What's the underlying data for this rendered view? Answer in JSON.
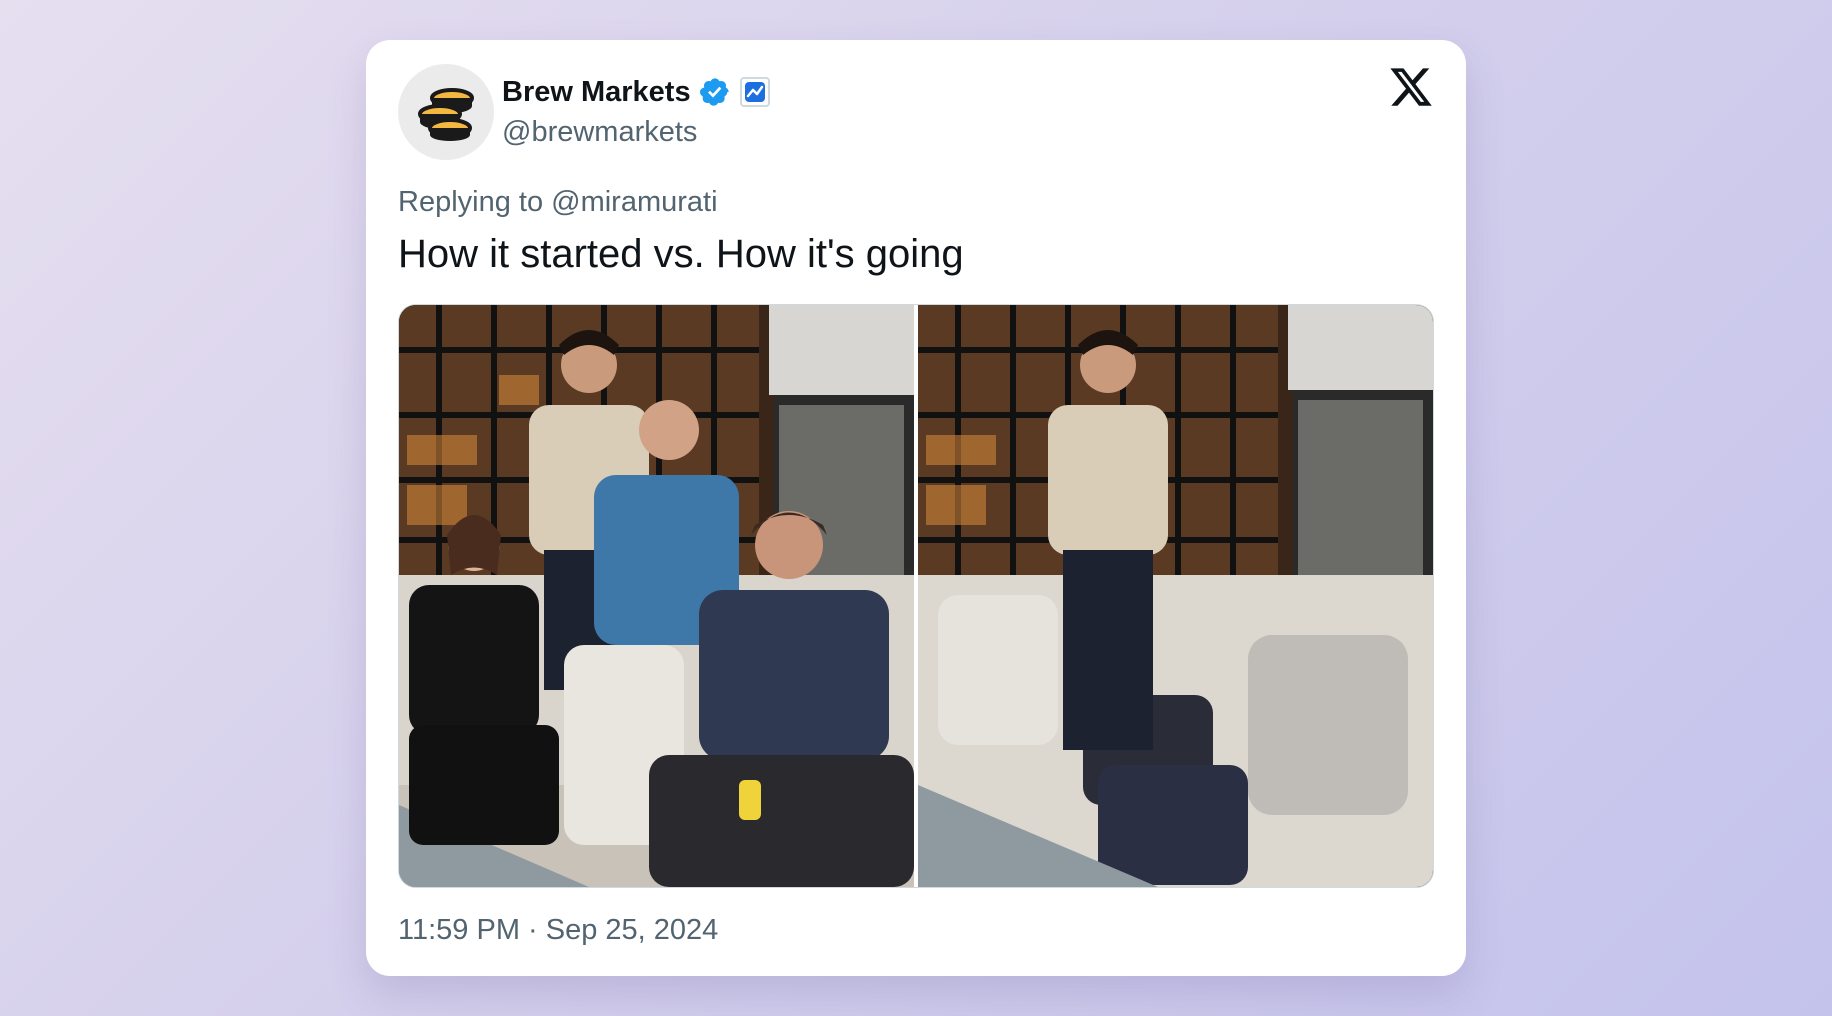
{
  "tweet": {
    "author": {
      "name": "Brew Markets",
      "handle": "@brewmarkets",
      "verified": true,
      "avatar_icon": "coin-stack-icon"
    },
    "platform_icon": "x-logo-icon",
    "reply_to": "Replying to @miramurati",
    "text": "How it started vs. How it's going",
    "media": [
      {
        "name": "photo-how-it-started"
      },
      {
        "name": "photo-how-its-going"
      }
    ],
    "timestamp": "11:59 PM · Sep 25, 2024"
  },
  "colors": {
    "verified": "#1d9bf0",
    "secondary_text": "#536471",
    "primary_text": "#0f1419"
  }
}
